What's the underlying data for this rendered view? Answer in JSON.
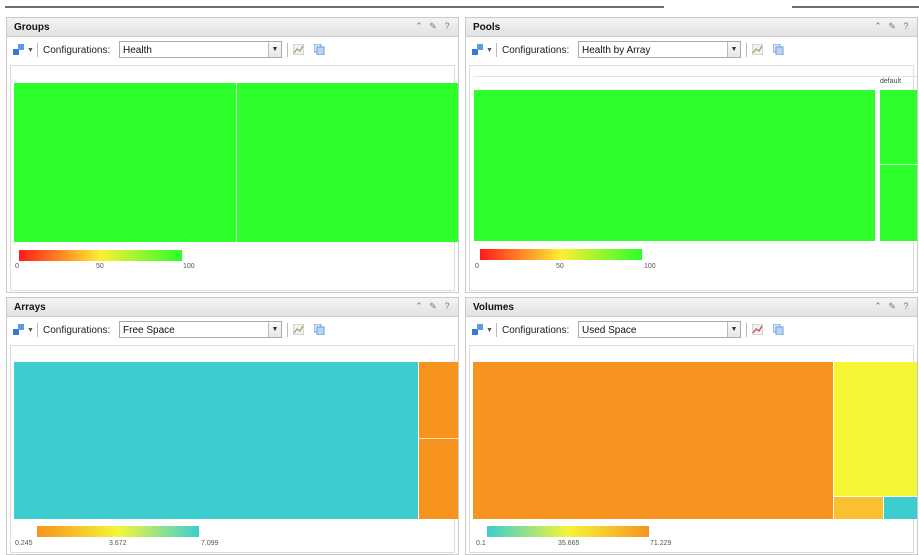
{
  "panels": {
    "groups": {
      "title": "Groups",
      "config_label": "Configurations:",
      "config_value": "Health",
      "legend": {
        "min": "0",
        "mid": "50",
        "max": "100",
        "colors": [
          "#ff1a1a",
          "#ffee33",
          "#2bff2b"
        ]
      },
      "tile_color": "#2cff2c"
    },
    "pools": {
      "title": "Pools",
      "config_label": "Configurations:",
      "config_value": "Health by Array",
      "group_label": "default",
      "legend": {
        "min": "0",
        "mid": "50",
        "max": "100",
        "colors": [
          "#ff1a1a",
          "#ffee33",
          "#2bff2b"
        ]
      },
      "tile_color": "#2cff2c"
    },
    "arrays": {
      "title": "Arrays",
      "config_label": "Configurations:",
      "config_value": "Free Space",
      "legend": {
        "min": "0.245",
        "mid": "3.672",
        "max": "7.099",
        "colors": [
          "#f7941d",
          "#f5f53a",
          "#3ccfd0"
        ]
      },
      "tile_colors": {
        "large": "#3ecdce",
        "small": "#f7941d"
      }
    },
    "volumes": {
      "title": "Volumes",
      "config_label": "Configurations:",
      "config_value": "Used Space",
      "legend": {
        "min": "0.1",
        "mid": "35.665",
        "max": "71.229",
        "colors": [
          "#3ccfd0",
          "#f5f53a",
          "#f7941d"
        ]
      },
      "tile_colors": {
        "large": "#f7941f",
        "right": "#f4f534",
        "small_orange": "#f9c030",
        "small_teal": "#3ecdce"
      }
    }
  },
  "header_icons": [
    "collapse-icon",
    "edit-icon",
    "help-icon"
  ]
}
